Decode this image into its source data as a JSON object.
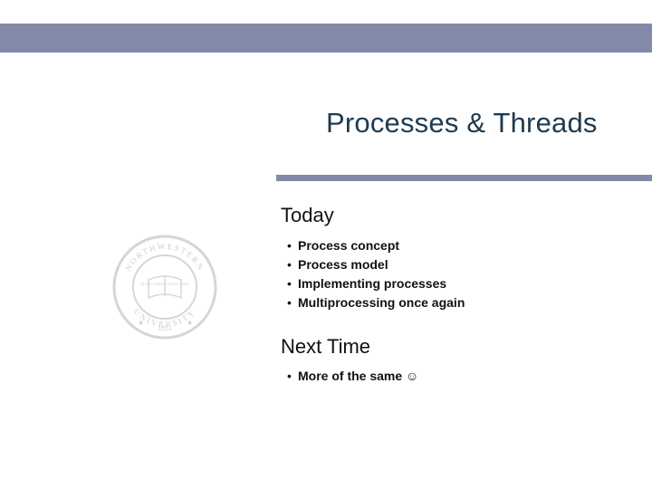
{
  "title": "Processes & Threads",
  "sections": {
    "today": {
      "heading": "Today",
      "items": [
        "Process concept",
        "Process model",
        "Implementing processes",
        "Multiprocessing once again"
      ]
    },
    "next": {
      "heading": "Next Time",
      "items": [
        "More of the same ☺"
      ]
    }
  },
  "seal": {
    "top_text": "NORTHWESTERN",
    "bottom_text": "UNIVERSITY",
    "motto": "QUAECUMQUE SUNT VERA",
    "year": "1851"
  },
  "colors": {
    "band": "#8389a9",
    "title": "#1e3b52"
  }
}
